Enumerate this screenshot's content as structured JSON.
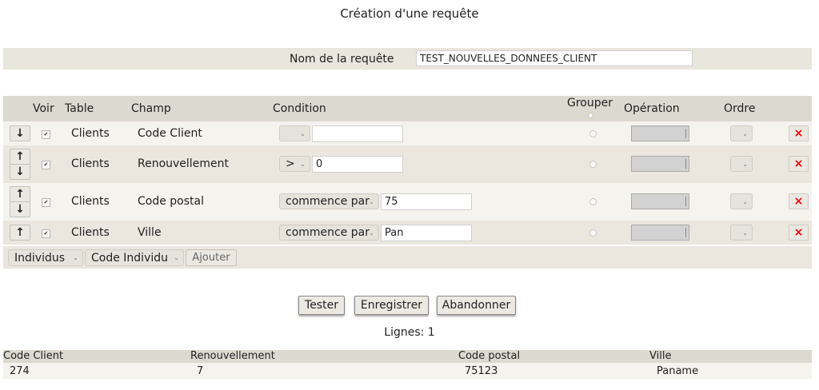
{
  "title": "Création d'une requête",
  "query_name": {
    "label": "Nom de la requête",
    "value": "TEST_NOUVELLES_DONNEES_CLIENT"
  },
  "columns": {
    "voir": "Voir",
    "table": "Table",
    "champ": "Champ",
    "condition": "Condition",
    "grouper": "Grouper",
    "operation": "Opération",
    "ordre": "Ordre"
  },
  "rows": [
    {
      "arrows": [
        "↓"
      ],
      "table": "Clients",
      "champ": "Code Client",
      "condition_op": "",
      "condition_value": ""
    },
    {
      "arrows": [
        "↑",
        "↓"
      ],
      "table": "Clients",
      "champ": "Renouvellement",
      "condition_op": ">",
      "condition_value": "0"
    },
    {
      "arrows": [
        "↑",
        "↓"
      ],
      "table": "Clients",
      "champ": "Code postal",
      "condition_op": "commence par",
      "condition_value": "75"
    },
    {
      "arrows": [
        "↑"
      ],
      "table": "Clients",
      "champ": "Ville",
      "condition_op": "commence par",
      "condition_value": "Pan"
    }
  ],
  "footer": {
    "table_select": "Individus",
    "field_select": "Code Individu",
    "add_button": "Ajouter"
  },
  "actions": {
    "tester": "Tester",
    "enregistrer": "Enregistrer",
    "abandonner": "Abandonner"
  },
  "lignes": "Lignes: 1",
  "results": {
    "headers": [
      "Code Client",
      "Renouvellement",
      "Code postal",
      "Ville"
    ],
    "rows": [
      [
        "274",
        "7",
        "75123",
        "Paname"
      ]
    ]
  },
  "icons": {
    "delete": "×",
    "checkbox": "✔"
  },
  "colors": {
    "delete": "#e00000",
    "bar": "#dcd9d0"
  }
}
